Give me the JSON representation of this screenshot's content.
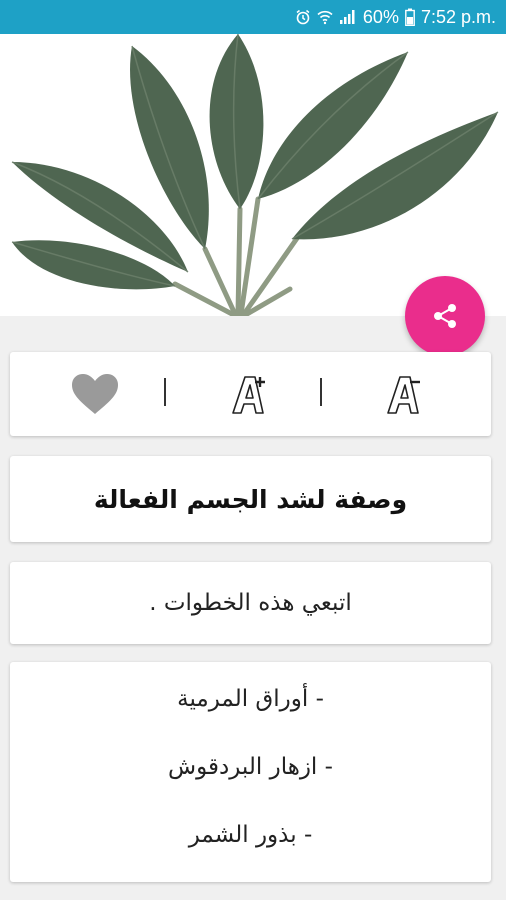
{
  "status_bar": {
    "battery_percent": "60%",
    "time": "7:52 p.m."
  },
  "hero": {
    "image": "sage-leaves-image"
  },
  "fab": {
    "icon": "share-icon",
    "color": "#ea2d8c"
  },
  "toolbar": {
    "favorite_icon": "heart-icon",
    "increase_font_icon": "font-increase-icon",
    "decrease_font_icon": "font-decrease-icon"
  },
  "recipe": {
    "title": "وصفة لشد الجسم الفعالة",
    "intro": "اتبعي هذه الخطوات .",
    "ingredients": [
      "- أوراق المرمية",
      "- ازهار البردقوش",
      "- بذور الشمر"
    ]
  },
  "colors": {
    "status_bar": "#1ea1c6",
    "accent": "#ea2d8c",
    "background": "#f0f0f0"
  }
}
